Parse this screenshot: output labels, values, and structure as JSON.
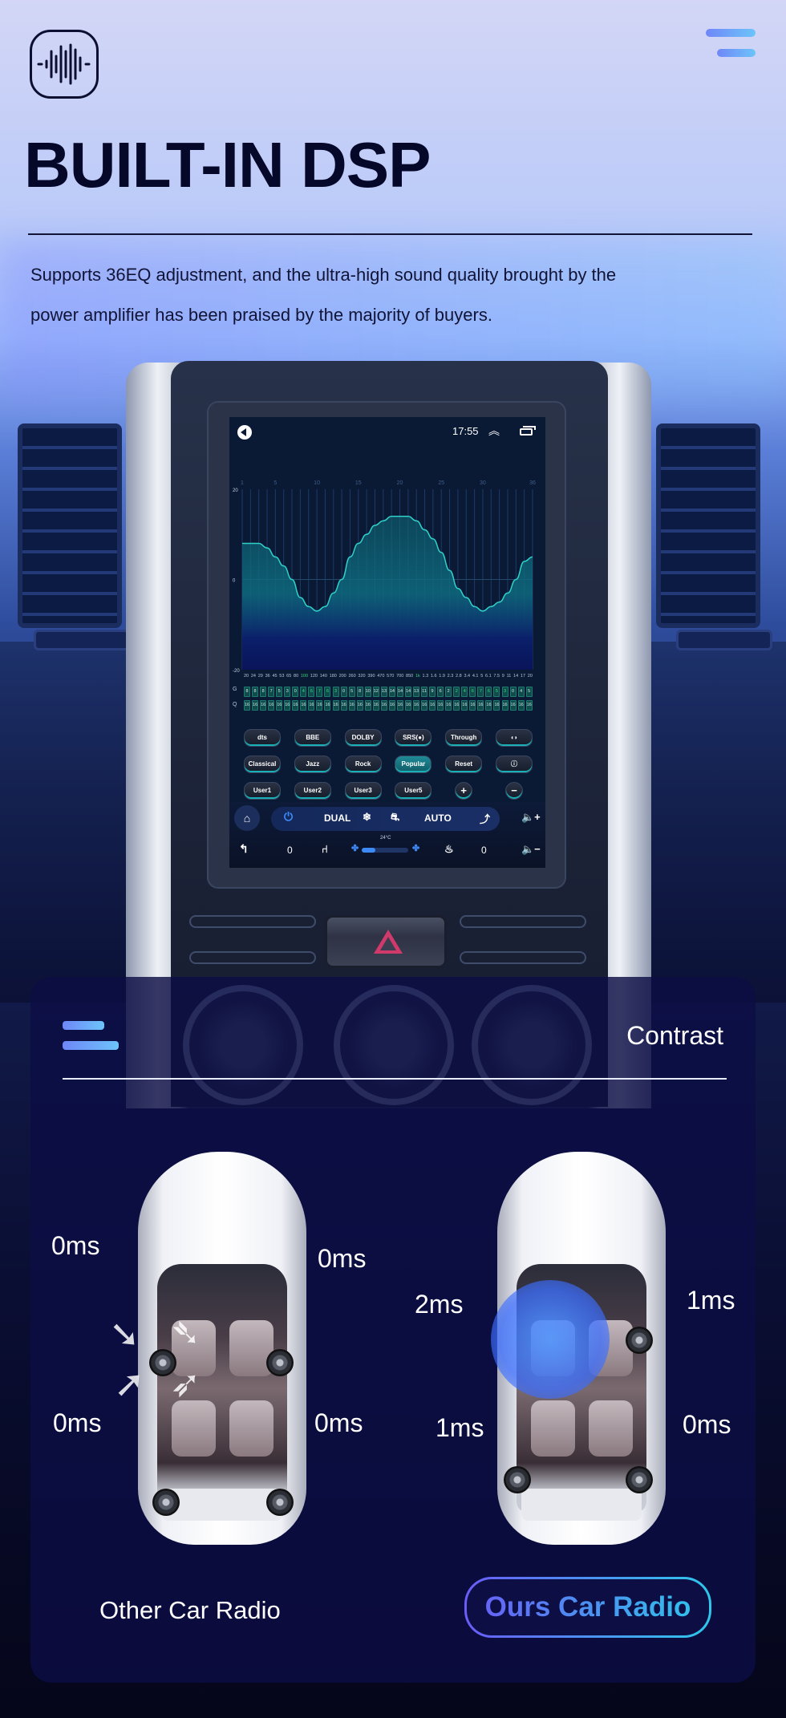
{
  "header": {
    "logo_icon": "sound-wave-icon",
    "menu_icon": "hamburger-icon",
    "title": "BUILT-IN DSP",
    "description_line1": "Supports 36EQ adjustment, and the ultra-high sound quality brought by the",
    "description_line2": "power amplifier has been praised by the majority of buyers."
  },
  "device": {
    "statusbar": {
      "back_icon": "back-circle-icon",
      "time": "17:55",
      "up_icon": "double-chevron-up-icon",
      "window_icon": "multi-window-icon"
    },
    "eq": {
      "band_ticks": [
        "1",
        "5",
        "10",
        "15",
        "20",
        "25",
        "30",
        "36"
      ],
      "y_ticks": [
        "20",
        "0",
        "-20"
      ],
      "y_range": [
        -20,
        20
      ],
      "curve_gain": [
        8,
        8,
        8,
        7,
        5,
        3,
        0,
        -4,
        -6,
        -7,
        -6,
        -3,
        0,
        5,
        8,
        10,
        12,
        13,
        14,
        14,
        14,
        13,
        11,
        9,
        6,
        2,
        -2,
        -4,
        -6,
        -7,
        -6,
        -5,
        -3,
        0,
        4,
        5
      ],
      "frequencies": [
        "20",
        "24",
        "29",
        "36",
        "45",
        "53",
        "65",
        "80",
        "100",
        "120",
        "140",
        "180",
        "200",
        "260",
        "320",
        "390",
        "470",
        "570",
        "700",
        "850",
        "1k",
        "1.3",
        "1.6",
        "1.9",
        "2.3",
        "2.8",
        "3.4",
        "4.1",
        "5",
        "6.1",
        "7.5",
        "9",
        "11",
        "14",
        "17",
        "20"
      ],
      "highlight_freqs": [
        "100",
        "1k"
      ],
      "g_label": "G",
      "q_label": "Q",
      "g_values": [
        "8",
        "8",
        "8",
        "7",
        "5",
        "3",
        "0",
        "4",
        "6",
        "7",
        "6",
        "3",
        "0",
        "5",
        "8",
        "10",
        "12",
        "13",
        "14",
        "14",
        "14",
        "13",
        "11",
        "9",
        "6",
        "2",
        "2",
        "4",
        "6",
        "7",
        "6",
        "5",
        "3",
        "0",
        "4",
        "5"
      ],
      "g_negative": [
        false,
        false,
        false,
        false,
        false,
        false,
        false,
        true,
        true,
        true,
        true,
        true,
        false,
        false,
        false,
        false,
        false,
        false,
        false,
        false,
        false,
        false,
        false,
        false,
        false,
        false,
        true,
        true,
        true,
        true,
        true,
        true,
        true,
        false,
        false,
        false
      ],
      "q_values": [
        "16",
        "16",
        "16",
        "16",
        "16",
        "16",
        "16",
        "16",
        "16",
        "16",
        "16",
        "16",
        "16",
        "16",
        "16",
        "16",
        "16",
        "16",
        "16",
        "16",
        "16",
        "16",
        "16",
        "16",
        "16",
        "16",
        "16",
        "16",
        "16",
        "16",
        "16",
        "16",
        "16",
        "16",
        "16",
        "16"
      ]
    },
    "presets": {
      "row1": [
        "dts",
        "BBE",
        "DOLBY",
        "SRS(●)",
        "Through",
        "◖◗"
      ],
      "row2": [
        "Classical",
        "Jazz",
        "Rock",
        "Popular",
        "Reset",
        "ⓘ"
      ],
      "row3": [
        "User1",
        "User2",
        "User3",
        "User5"
      ],
      "plus": "+",
      "minus": "−",
      "active": "Popular"
    },
    "climate": {
      "home_icon": "home-icon",
      "power_icon": "power-icon",
      "dual": "DUAL",
      "snow_icon": "snowflake-icon",
      "recirc_icon": "car-recirculation-icon",
      "auto": "AUTO",
      "airflow_icon": "seat-airflow-icon",
      "vol_up_icon": "volume-up-icon",
      "temp": "24°C",
      "back_icon": "back-arrow-icon",
      "left_seat_value": "0",
      "seat_icon": "seat-icon",
      "fan_level": 0.3,
      "seat_heat_icon": "seat-heat-icon",
      "right_seat_value": "0",
      "vol_down_icon": "volume-down-icon"
    },
    "hazard_icon": "hazard-triangle-icon"
  },
  "contrast": {
    "menu_icon": "hamburger-icon",
    "label": "Contrast",
    "other": {
      "front_left": "0ms",
      "front_right": "0ms",
      "rear_left": "0ms",
      "rear_right": "0ms",
      "caption": "Other Car Radio"
    },
    "ours": {
      "front_left": "2ms",
      "front_right": "1ms",
      "rear_left": "1ms",
      "rear_right": "0ms",
      "caption": "Ours Car Radio"
    }
  }
}
